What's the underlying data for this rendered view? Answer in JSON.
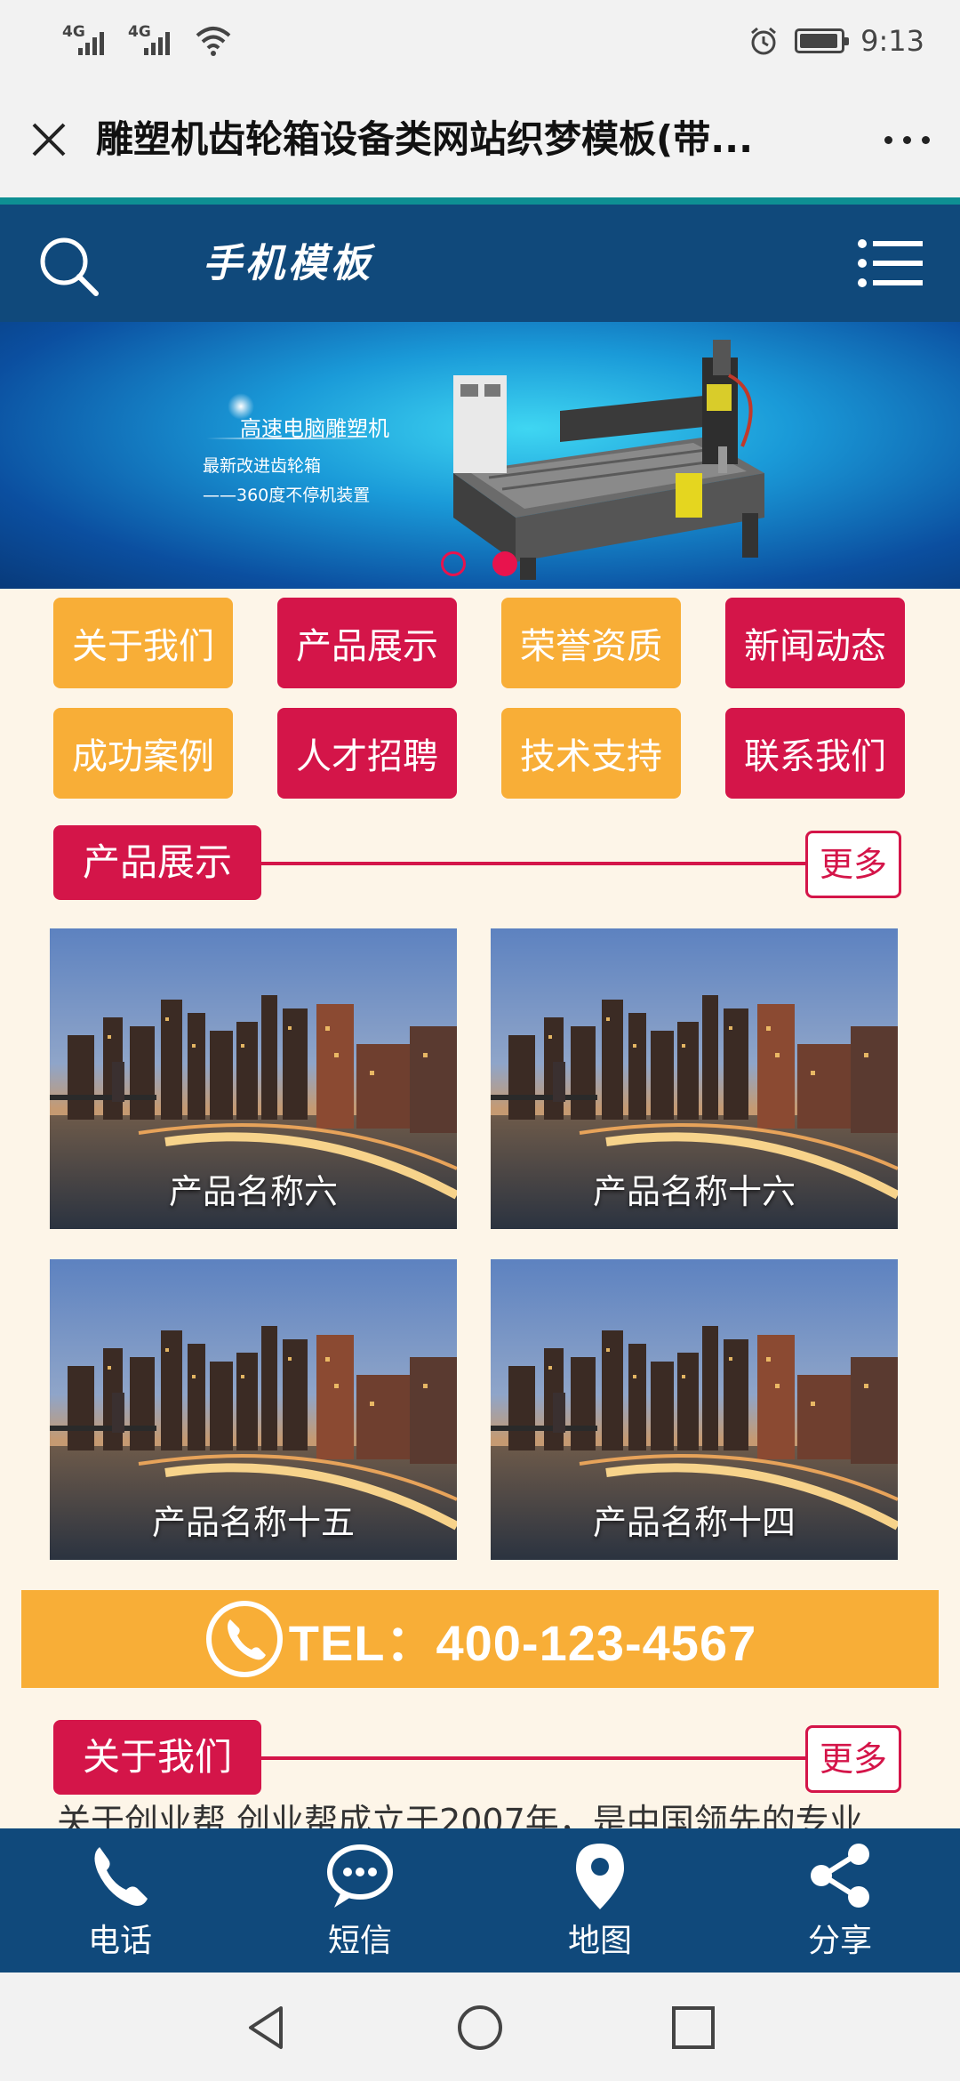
{
  "status_bar": {
    "signal_1": "4G",
    "signal_2": "4G",
    "time": "9:13",
    "icons": [
      "signal-icon",
      "wifi-icon",
      "alarm-icon",
      "battery-icon"
    ]
  },
  "title_bar": {
    "title": "雕塑机齿轮箱设备类网站织梦模板(带...",
    "icons": [
      "close-icon",
      "more-icon"
    ]
  },
  "site_header": {
    "logo": "手机模板",
    "icons": [
      "search-icon",
      "menu-icon"
    ],
    "colors": {
      "header": "#10497b",
      "accent_top": "#0e8f93"
    }
  },
  "banner": {
    "heading": "高速电脑雕塑机",
    "line1": "最新改进齿轮箱",
    "line2": "——360度不停机装置",
    "slide_count": 2,
    "active_slide": 2
  },
  "nav_grid": {
    "items": [
      {
        "label": "关于我们",
        "color": "orange"
      },
      {
        "label": "产品展示",
        "color": "red"
      },
      {
        "label": "荣誉资质",
        "color": "orange"
      },
      {
        "label": "新闻动态",
        "color": "red"
      },
      {
        "label": "成功案例",
        "color": "orange"
      },
      {
        "label": "人才招聘",
        "color": "red"
      },
      {
        "label": "技术支持",
        "color": "orange"
      },
      {
        "label": "联系我们",
        "color": "red"
      }
    ],
    "colors": {
      "orange": "#f8ae37",
      "red": "#d41549"
    }
  },
  "products_section": {
    "title": "产品展示",
    "more": "更多",
    "items": [
      {
        "name": "产品名称六"
      },
      {
        "name": "产品名称十六"
      },
      {
        "name": "产品名称十五"
      },
      {
        "name": "产品名称十四"
      }
    ]
  },
  "tel_bar": {
    "text": "TEL：400-123-4567",
    "icon": "phone-icon"
  },
  "about_section": {
    "title": "关于我们",
    "more": "更多",
    "text": "关于创业帮 创业帮成立于2007年，是中国领先的专业"
  },
  "bottom_nav": {
    "items": [
      {
        "label": "电话",
        "icon": "phone-icon"
      },
      {
        "label": "短信",
        "icon": "message-icon"
      },
      {
        "label": "地图",
        "icon": "map-pin-icon"
      },
      {
        "label": "分享",
        "icon": "share-icon"
      }
    ]
  },
  "system_nav": {
    "icons": [
      "back-icon",
      "home-icon",
      "recents-icon"
    ]
  }
}
